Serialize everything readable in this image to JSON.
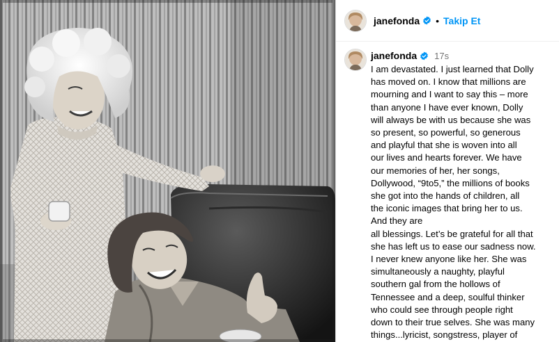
{
  "header": {
    "username": "janefonda",
    "separator": "•",
    "follow_label": "Takip Et"
  },
  "post": {
    "username": "janefonda",
    "timestamp": "17s",
    "lines": [
      "I am devastated. I just learned that Dolly",
      "has moved on. I know that millions are",
      "mourning and I want to say this – more",
      "than anyone I have ever known, Dolly",
      "will always be with us because she was",
      "so present, so powerful, so generous",
      "and playful that she is woven into all",
      "our lives and hearts forever. We have",
      "our memories of her, her songs,",
      "Dollywood, “9to5,” the millions of books",
      "she got into the hands of children, all",
      "the iconic images that bring her to us.",
      "And they are",
      "all blessings. Let’s be grateful for all that",
      "she has left us to ease our sadness now.",
      "I never knew anyone like her. She was",
      "simultaneously a naughty, playful",
      "southern gal from the hollows of",
      "Tennessee and a deep, soulful thinker",
      "who could see through people right",
      "down to their true selves. She was many",
      "things...lyricist, songstress, player of"
    ]
  },
  "colors": {
    "follow": "#0095f6",
    "verified": "#0095f6",
    "timestamp": "#737373",
    "divider": "#dbdbdb"
  },
  "icons": {
    "verified": "verified-badge-icon"
  }
}
